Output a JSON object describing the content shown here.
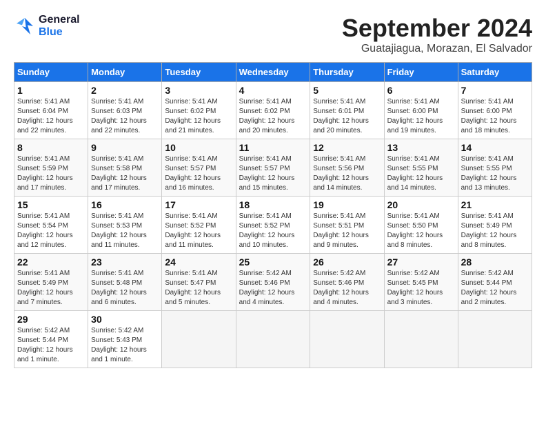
{
  "logo": {
    "line1": "General",
    "line2": "Blue"
  },
  "title": "September 2024",
  "subtitle": "Guatajiagua, Morazan, El Salvador",
  "days_of_week": [
    "Sunday",
    "Monday",
    "Tuesday",
    "Wednesday",
    "Thursday",
    "Friday",
    "Saturday"
  ],
  "weeks": [
    [
      {
        "day": "1",
        "info": "Sunrise: 5:41 AM\nSunset: 6:04 PM\nDaylight: 12 hours\nand 22 minutes."
      },
      {
        "day": "2",
        "info": "Sunrise: 5:41 AM\nSunset: 6:03 PM\nDaylight: 12 hours\nand 22 minutes."
      },
      {
        "day": "3",
        "info": "Sunrise: 5:41 AM\nSunset: 6:02 PM\nDaylight: 12 hours\nand 21 minutes."
      },
      {
        "day": "4",
        "info": "Sunrise: 5:41 AM\nSunset: 6:02 PM\nDaylight: 12 hours\nand 20 minutes."
      },
      {
        "day": "5",
        "info": "Sunrise: 5:41 AM\nSunset: 6:01 PM\nDaylight: 12 hours\nand 20 minutes."
      },
      {
        "day": "6",
        "info": "Sunrise: 5:41 AM\nSunset: 6:00 PM\nDaylight: 12 hours\nand 19 minutes."
      },
      {
        "day": "7",
        "info": "Sunrise: 5:41 AM\nSunset: 6:00 PM\nDaylight: 12 hours\nand 18 minutes."
      }
    ],
    [
      {
        "day": "8",
        "info": "Sunrise: 5:41 AM\nSunset: 5:59 PM\nDaylight: 12 hours\nand 17 minutes."
      },
      {
        "day": "9",
        "info": "Sunrise: 5:41 AM\nSunset: 5:58 PM\nDaylight: 12 hours\nand 17 minutes."
      },
      {
        "day": "10",
        "info": "Sunrise: 5:41 AM\nSunset: 5:57 PM\nDaylight: 12 hours\nand 16 minutes."
      },
      {
        "day": "11",
        "info": "Sunrise: 5:41 AM\nSunset: 5:57 PM\nDaylight: 12 hours\nand 15 minutes."
      },
      {
        "day": "12",
        "info": "Sunrise: 5:41 AM\nSunset: 5:56 PM\nDaylight: 12 hours\nand 14 minutes."
      },
      {
        "day": "13",
        "info": "Sunrise: 5:41 AM\nSunset: 5:55 PM\nDaylight: 12 hours\nand 14 minutes."
      },
      {
        "day": "14",
        "info": "Sunrise: 5:41 AM\nSunset: 5:55 PM\nDaylight: 12 hours\nand 13 minutes."
      }
    ],
    [
      {
        "day": "15",
        "info": "Sunrise: 5:41 AM\nSunset: 5:54 PM\nDaylight: 12 hours\nand 12 minutes."
      },
      {
        "day": "16",
        "info": "Sunrise: 5:41 AM\nSunset: 5:53 PM\nDaylight: 12 hours\nand 11 minutes."
      },
      {
        "day": "17",
        "info": "Sunrise: 5:41 AM\nSunset: 5:52 PM\nDaylight: 12 hours\nand 11 minutes."
      },
      {
        "day": "18",
        "info": "Sunrise: 5:41 AM\nSunset: 5:52 PM\nDaylight: 12 hours\nand 10 minutes."
      },
      {
        "day": "19",
        "info": "Sunrise: 5:41 AM\nSunset: 5:51 PM\nDaylight: 12 hours\nand 9 minutes."
      },
      {
        "day": "20",
        "info": "Sunrise: 5:41 AM\nSunset: 5:50 PM\nDaylight: 12 hours\nand 8 minutes."
      },
      {
        "day": "21",
        "info": "Sunrise: 5:41 AM\nSunset: 5:49 PM\nDaylight: 12 hours\nand 8 minutes."
      }
    ],
    [
      {
        "day": "22",
        "info": "Sunrise: 5:41 AM\nSunset: 5:49 PM\nDaylight: 12 hours\nand 7 minutes."
      },
      {
        "day": "23",
        "info": "Sunrise: 5:41 AM\nSunset: 5:48 PM\nDaylight: 12 hours\nand 6 minutes."
      },
      {
        "day": "24",
        "info": "Sunrise: 5:41 AM\nSunset: 5:47 PM\nDaylight: 12 hours\nand 5 minutes."
      },
      {
        "day": "25",
        "info": "Sunrise: 5:42 AM\nSunset: 5:46 PM\nDaylight: 12 hours\nand 4 minutes."
      },
      {
        "day": "26",
        "info": "Sunrise: 5:42 AM\nSunset: 5:46 PM\nDaylight: 12 hours\nand 4 minutes."
      },
      {
        "day": "27",
        "info": "Sunrise: 5:42 AM\nSunset: 5:45 PM\nDaylight: 12 hours\nand 3 minutes."
      },
      {
        "day": "28",
        "info": "Sunrise: 5:42 AM\nSunset: 5:44 PM\nDaylight: 12 hours\nand 2 minutes."
      }
    ],
    [
      {
        "day": "29",
        "info": "Sunrise: 5:42 AM\nSunset: 5:44 PM\nDaylight: 12 hours\nand 1 minute."
      },
      {
        "day": "30",
        "info": "Sunrise: 5:42 AM\nSunset: 5:43 PM\nDaylight: 12 hours\nand 1 minute."
      },
      {
        "day": "",
        "info": ""
      },
      {
        "day": "",
        "info": ""
      },
      {
        "day": "",
        "info": ""
      },
      {
        "day": "",
        "info": ""
      },
      {
        "day": "",
        "info": ""
      }
    ]
  ]
}
